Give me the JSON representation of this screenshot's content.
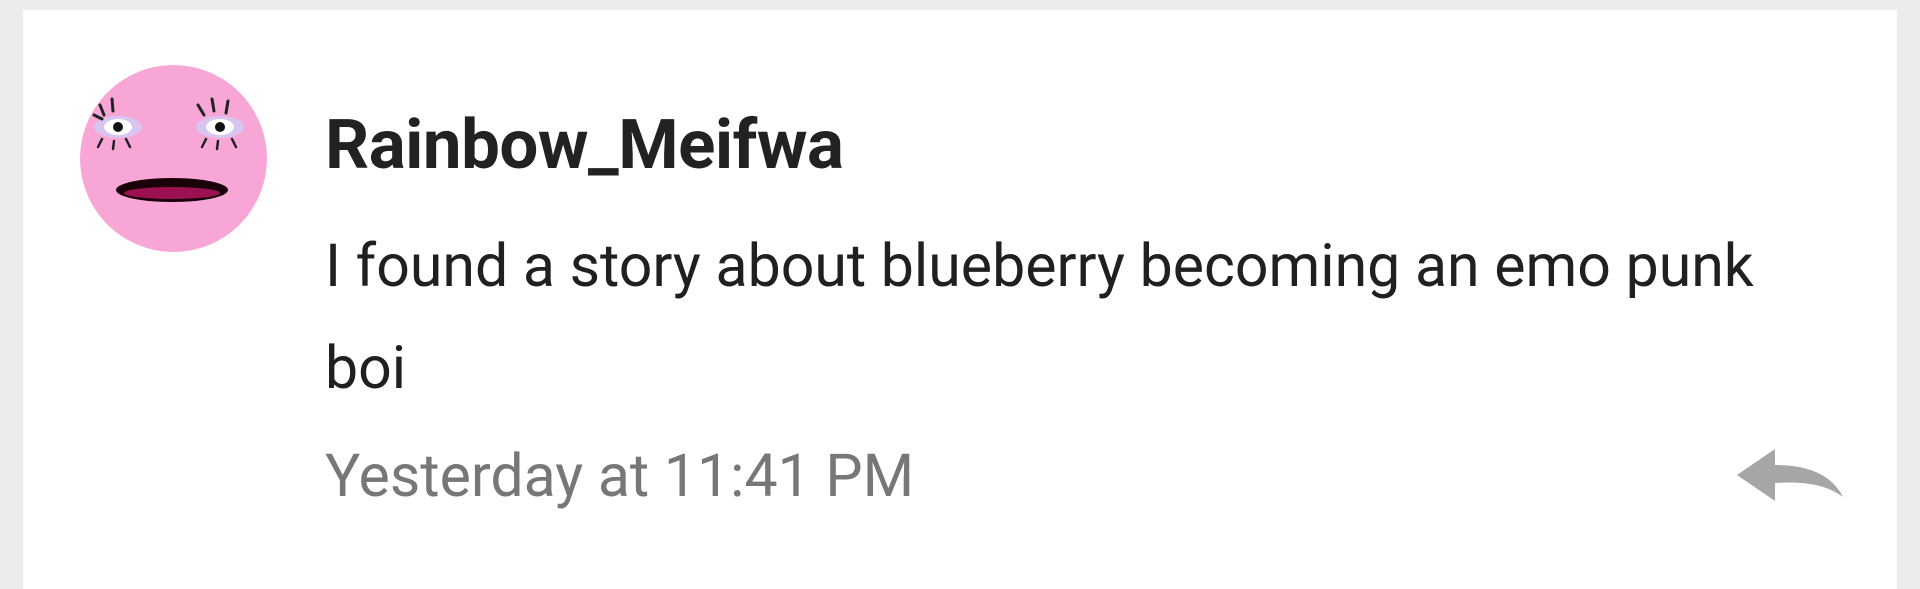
{
  "comment": {
    "author": "Rainbow_Meifwa",
    "text": "I found a story about blueberry becoming an emo punk boi",
    "timestamp": "Yesterday at 11:41 PM",
    "avatar_icon": "pink-face-avatar",
    "reply_icon": "reply-arrow-icon"
  },
  "colors": {
    "background": "#ececec",
    "card": "#ffffff",
    "author_text": "#222222",
    "body_text": "#202020",
    "meta_text": "#777777",
    "reply_icon": "#a6a6a6",
    "avatar_pink": "#f7a6d6"
  }
}
